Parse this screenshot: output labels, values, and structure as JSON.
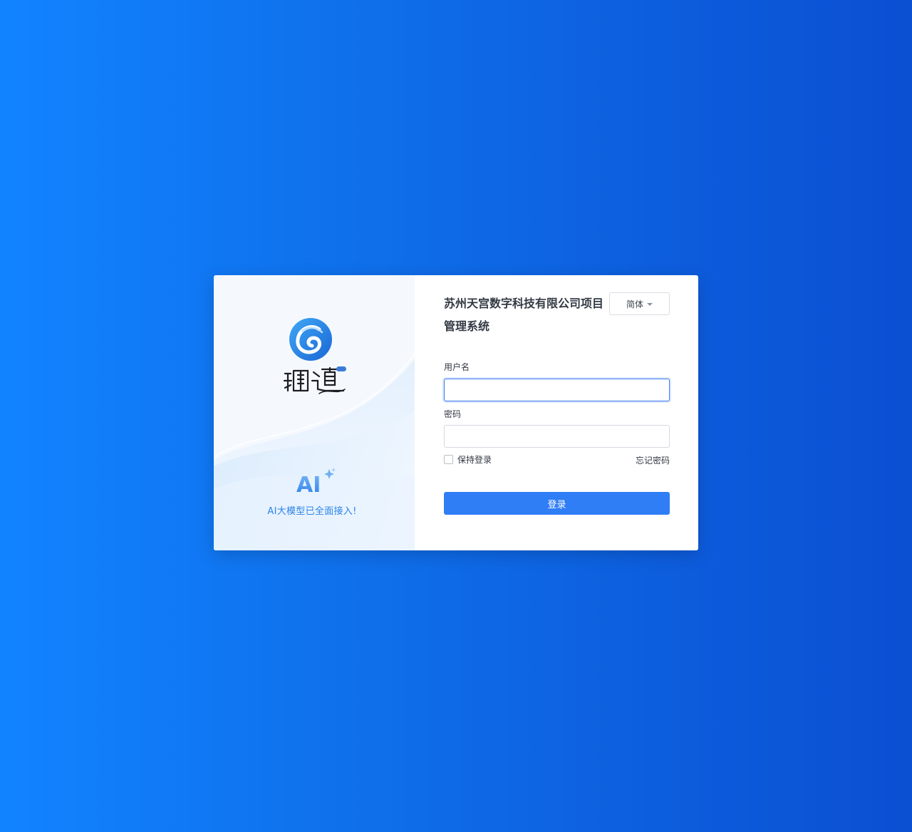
{
  "header": {
    "title": "苏州天宫数字科技有限公司项目管理系统",
    "language_label": "简体"
  },
  "branding": {
    "logo_icon": "zentao-logo-icon",
    "ai_badge_text": "AI",
    "ai_tagline": "AI大模型已全面接入!"
  },
  "form": {
    "username_label": "用户名",
    "username_value": "",
    "password_label": "密码",
    "password_value": "",
    "remember_label": "保持登录",
    "forgot_label": "忘记密码",
    "submit_label": "登录"
  },
  "colors": {
    "background_start": "#1283ff",
    "background_end": "#0b4fd3",
    "primary_button": "#2f7ef5",
    "ai_text": "#2b83e8"
  }
}
